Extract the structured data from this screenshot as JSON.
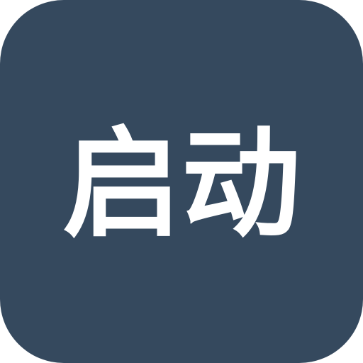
{
  "icon": {
    "label": "启动",
    "background_color": "#35495e",
    "text_color": "#ffffff"
  }
}
